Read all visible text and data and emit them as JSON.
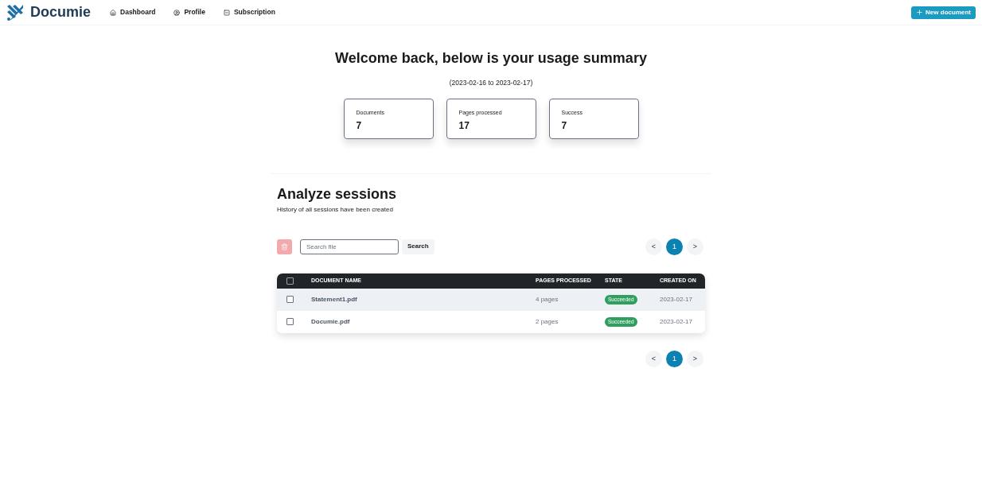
{
  "brand": {
    "name": "Documie"
  },
  "nav": [
    {
      "label": "Dashboard",
      "kind": "home"
    },
    {
      "label": "Profile",
      "kind": "user"
    },
    {
      "label": "Subscription",
      "kind": "doc"
    }
  ],
  "new_button": {
    "label": "New document"
  },
  "summary": {
    "title": "Welcome back, below is your usage summary",
    "range": "(2023-02-16 to 2023-02-17)",
    "cards": [
      {
        "label": "Documents",
        "value": "7"
      },
      {
        "label": "Pages processed",
        "value": "17"
      },
      {
        "label": "Success",
        "value": "7"
      }
    ]
  },
  "sessions": {
    "title": "Analyze sessions",
    "subtitle": "History of all sessions have been created",
    "delete_disabled": true,
    "search": {
      "placeholder": "Search file",
      "button": "Search"
    },
    "pagination_top": {
      "prev": "<",
      "next": ">",
      "pages": [
        {
          "label": "1",
          "selected": true
        }
      ]
    },
    "columns": [
      "DOCUMENT NAME",
      "PAGES PROCESSED",
      "STATE",
      "CREATED ON"
    ],
    "header_checked": false,
    "rows": [
      {
        "name": "Statement1.pdf",
        "pages": "4 pages",
        "state": "Succeeded",
        "color": "#2f9e5f",
        "created": "2023-02-17",
        "checked": false,
        "highlighted": true
      },
      {
        "name": "Documie.pdf",
        "pages": "2 pages",
        "state": "Succeeded",
        "color": "#2f9e5f",
        "created": "2023-02-17",
        "checked": false,
        "highlighted": false
      }
    ],
    "pagination_bottom": {
      "prev": "<",
      "next": ">",
      "pages": [
        {
          "label": "1",
          "selected": true
        }
      ]
    }
  }
}
